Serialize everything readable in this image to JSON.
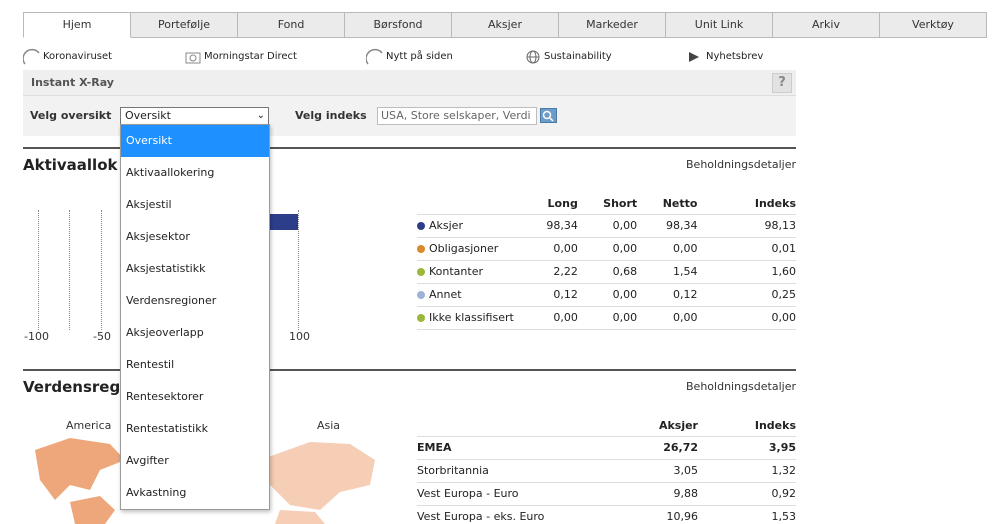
{
  "tabs": [
    "Hjem",
    "Portefølje",
    "Fond",
    "Børsfond",
    "Aksjer",
    "Markeder",
    "Unit Link",
    "Arkiv",
    "Verktøy"
  ],
  "links": [
    {
      "label": "Koronaviruset",
      "icon": "circle-icon"
    },
    {
      "label": "Morningstar Direct",
      "icon": "direct-icon"
    },
    {
      "label": "Nytt på siden",
      "icon": "circle-icon"
    },
    {
      "label": "Sustainability",
      "icon": "globe-icon"
    },
    {
      "label": "Nyhetsbrev",
      "icon": "play-icon"
    }
  ],
  "xray": {
    "title": "Instant X-Ray",
    "help": "?",
    "overview_label": "Velg oversikt",
    "overview_value": "Oversikt",
    "index_label": "Velg indeks",
    "index_value": "USA, Store selskaper, Verdi"
  },
  "allocation": {
    "title": "Aktivaallok",
    "details_link": "Beholdningsdetaljer",
    "axis_labels": [
      "-100",
      "-50",
      "100"
    ],
    "columns": [
      "Long",
      "Short",
      "Netto",
      "Indeks"
    ],
    "rows": [
      {
        "name": "Aksjer",
        "color": "#2c3e8a",
        "long": "98,34",
        "short": "0,00",
        "netto": "98,34",
        "index": "98,13"
      },
      {
        "name": "Obligasjoner",
        "color": "#d98b2b",
        "long": "0,00",
        "short": "0,00",
        "netto": "0,00",
        "index": "0,01"
      },
      {
        "name": "Kontanter",
        "color": "#9ab83a",
        "long": "2,22",
        "short": "0,68",
        "netto": "1,54",
        "index": "1,60"
      },
      {
        "name": "Annet",
        "color": "#9fb3d6",
        "long": "0,12",
        "short": "0,00",
        "netto": "0,12",
        "index": "0,25"
      },
      {
        "name": "Ikke klassifisert",
        "color": "#9ab83a",
        "long": "0,00",
        "short": "0,00",
        "netto": "0,00",
        "index": "0,00"
      }
    ]
  },
  "regions": {
    "title": "Verdensreg",
    "details_link": "Beholdningsdetaljer",
    "map_labels": [
      "America",
      "Asia"
    ],
    "columns": [
      "Aksjer",
      "Indeks"
    ],
    "rows": [
      {
        "name": "EMEA",
        "aksjer": "26,72",
        "index": "3,95",
        "bold": true
      },
      {
        "name": "Storbritannia",
        "aksjer": "3,05",
        "index": "1,32",
        "bold": false
      },
      {
        "name": "Vest Europa - Euro",
        "aksjer": "9,88",
        "index": "0,92",
        "bold": false
      },
      {
        "name": "Vest Europa - eks. Euro",
        "aksjer": "10,96",
        "index": "1,53",
        "bold": false
      }
    ]
  },
  "dropdown": {
    "items": [
      "Oversikt",
      "Aktivaallokering",
      "Aksjestil",
      "Aksjesektor",
      "Aksjestatistikk",
      "Verdensregioner",
      "Aksjeoverlapp",
      "Rentestil",
      "Rentesektorer",
      "Rentestatistikk",
      "Avgifter",
      "Avkastning"
    ],
    "selected": 0
  }
}
